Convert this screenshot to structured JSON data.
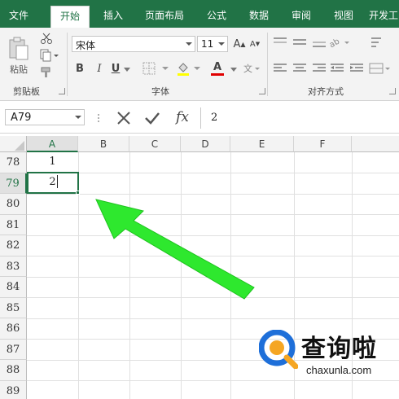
{
  "ribbon_tabs": [
    {
      "label": "文件",
      "active": false
    },
    {
      "label": "开始",
      "active": true
    },
    {
      "label": "插入",
      "active": false
    },
    {
      "label": "页面布局",
      "active": false
    },
    {
      "label": "公式",
      "active": false
    },
    {
      "label": "数据",
      "active": false
    },
    {
      "label": "审阅",
      "active": false
    },
    {
      "label": "视图",
      "active": false
    },
    {
      "label": "开发工",
      "active": false
    }
  ],
  "clipboard": {
    "paste_label": "粘贴",
    "group_label": "剪贴板"
  },
  "font": {
    "name": "宋体",
    "size": "11",
    "group_label": "字体",
    "bold": "B",
    "italic": "I",
    "underline": "U",
    "font_color_glyph": "A",
    "grow_glyph": "A",
    "shrink_glyph": "A"
  },
  "alignment": {
    "group_label": "对齐方式"
  },
  "formula_bar": {
    "name_box": "A79",
    "fx_label": "fx",
    "formula_value": "2"
  },
  "columns": [
    "A",
    "B",
    "C",
    "D",
    "E",
    "F"
  ],
  "selected_column": "A",
  "rows": [
    {
      "num": "78",
      "a": "1"
    },
    {
      "num": "79",
      "a": "2"
    },
    {
      "num": "80",
      "a": ""
    },
    {
      "num": "81",
      "a": ""
    },
    {
      "num": "82",
      "a": ""
    },
    {
      "num": "83",
      "a": ""
    },
    {
      "num": "84",
      "a": ""
    },
    {
      "num": "85",
      "a": ""
    },
    {
      "num": "86",
      "a": ""
    },
    {
      "num": "87",
      "a": ""
    },
    {
      "num": "88",
      "a": ""
    },
    {
      "num": "89",
      "a": ""
    }
  ],
  "selected_row": "79",
  "watermark": {
    "brand": "查询啦",
    "url": "chaxunla.com"
  },
  "colors": {
    "excel_green": "#217346",
    "arrow_green": "#2ee82e",
    "watermark_blue": "#1e6fd9",
    "watermark_orange": "#f5a623"
  }
}
